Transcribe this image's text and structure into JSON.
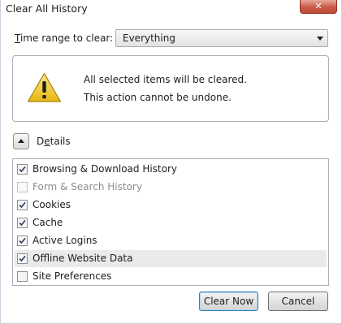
{
  "window": {
    "title": "Clear All History",
    "close_glyph": "✕"
  },
  "time_range": {
    "label_accesskey": "T",
    "label_rest": "ime range to clear:",
    "selected": "Everything"
  },
  "warning": {
    "icon": "warning-triangle-icon",
    "line1": "All selected items will be cleared.",
    "line2": "This action cannot be undone."
  },
  "details": {
    "toggle_icon": "chevron-up-icon",
    "label_pre": "D",
    "label_accesskey": "e",
    "label_rest": "tails"
  },
  "items": [
    {
      "label": "Browsing & Download History",
      "checked": true,
      "disabled": false
    },
    {
      "label": "Form & Search History",
      "checked": false,
      "disabled": true
    },
    {
      "label": "Cookies",
      "checked": true,
      "disabled": false
    },
    {
      "label": "Cache",
      "checked": true,
      "disabled": false
    },
    {
      "label": "Active Logins",
      "checked": true,
      "disabled": false
    },
    {
      "label": "Offline Website Data",
      "checked": true,
      "disabled": false,
      "highlighted": true
    },
    {
      "label": "Site Preferences",
      "checked": false,
      "disabled": false
    }
  ],
  "buttons": {
    "clear_now": "Clear Now",
    "cancel": "Cancel"
  },
  "colors": {
    "close_button": "#c95a47",
    "warning_yellow": "#f4d03f",
    "default_button_border": "#3c7fb1",
    "check_mark": "#2b3f5f"
  }
}
